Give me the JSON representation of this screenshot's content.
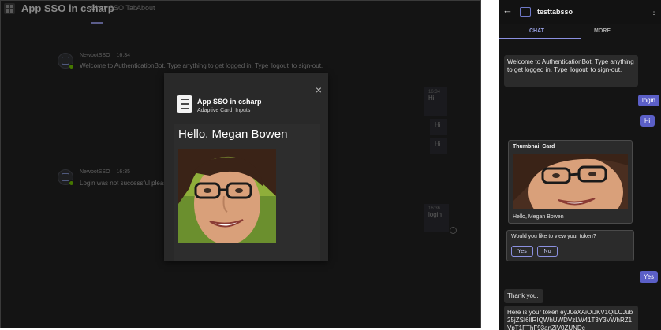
{
  "desktop": {
    "app_title": "App SSO in csharp",
    "tabs": [
      "Chat",
      "SSO Tab",
      "About"
    ],
    "messages": [
      {
        "sender": "NewbotSSO",
        "time": "16:34",
        "text": "Welcome to AuthenticationBot. Type anything to get logged in. Type 'logout' to sign-out."
      },
      {
        "sender": "NewbotSSO",
        "time": "16:35",
        "text": "Login was not successful please t"
      }
    ],
    "user_messages": [
      {
        "time": "16:34",
        "text": "Hi"
      },
      {
        "text": "Hi"
      },
      {
        "text": "Hi"
      },
      {
        "time": "16:36",
        "text": "login"
      }
    ],
    "modal": {
      "title": "App SSO in csharp",
      "subtitle": "Adaptive Card: Inputs",
      "greeting": "Hello, Megan Bowen",
      "close": "×"
    }
  },
  "mobile": {
    "bot_name": "testtabsso",
    "tabs": [
      "CHAT",
      "MORE"
    ],
    "welcome": "Welcome to AuthenticationBot. Type anything to get logged in. Type 'logout' to sign-out.",
    "user_messages": [
      "login",
      "Hi",
      "Yes"
    ],
    "thumbnail_card": {
      "title": "Thumbnail Card",
      "name": "Hello, Megan Bowen"
    },
    "question": {
      "text": "Would you like to view your token?",
      "yes": "Yes",
      "no": "No"
    },
    "thanks": "Thank you.",
    "token_text": "Here is your token eyJ0eXAiOiJKV1QiLCJub25jZSI6IlRIQWhUWDVzLW41T3Y3VWhRZ1VpT1FThF93anZiV0ZUNDc"
  },
  "colors": {
    "accent": "#5b5fc7",
    "presence": "#6bb700"
  }
}
